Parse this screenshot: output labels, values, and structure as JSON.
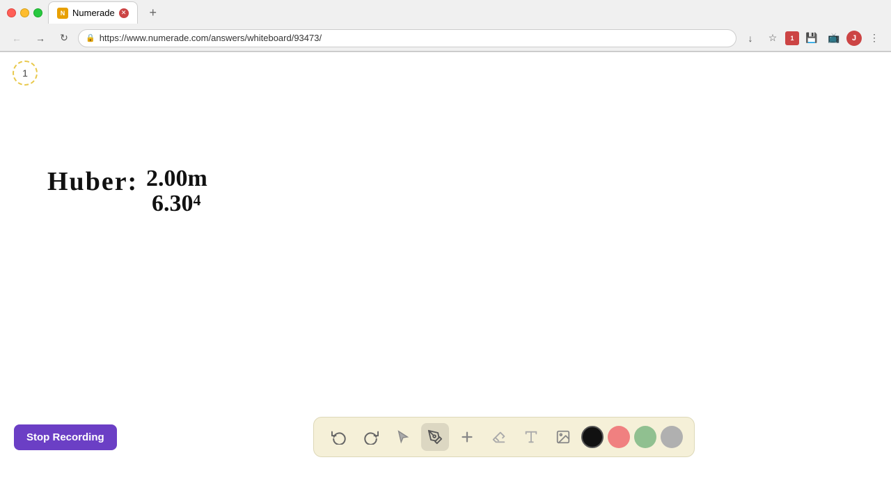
{
  "browser": {
    "tab_title": "Numerade",
    "tab_favicon_text": "N",
    "url": "https://www.numerade.com/answers/whiteboard/93473/",
    "back_tooltip": "Back",
    "forward_tooltip": "Forward",
    "reload_tooltip": "Reload"
  },
  "slide_badge": "1",
  "handwriting": {
    "line1": "Huber:  2.00m",
    "line2": "         6.30⁴"
  },
  "toolbar": {
    "stop_recording_label": "Stop Recording",
    "tools": [
      {
        "id": "undo",
        "label": "↺",
        "icon": "undo-icon"
      },
      {
        "id": "redo",
        "label": "↻",
        "icon": "redo-icon"
      },
      {
        "id": "select",
        "label": "↖",
        "icon": "select-icon"
      },
      {
        "id": "pen",
        "label": "✏",
        "icon": "pen-icon"
      },
      {
        "id": "add",
        "label": "+",
        "icon": "add-icon"
      },
      {
        "id": "eraser",
        "label": "/",
        "icon": "eraser-icon"
      },
      {
        "id": "text",
        "label": "A",
        "icon": "text-icon"
      },
      {
        "id": "image",
        "label": "🖼",
        "icon": "image-icon"
      }
    ],
    "colors": [
      {
        "id": "black",
        "value": "#111111",
        "selected": true
      },
      {
        "id": "pink",
        "value": "#f08080"
      },
      {
        "id": "green",
        "value": "#90c090"
      },
      {
        "id": "gray",
        "value": "#b0b0b0"
      }
    ]
  },
  "colors": {
    "stop_btn_bg": "#6b3fc5",
    "toolbar_bg": "#f5f0d8"
  }
}
